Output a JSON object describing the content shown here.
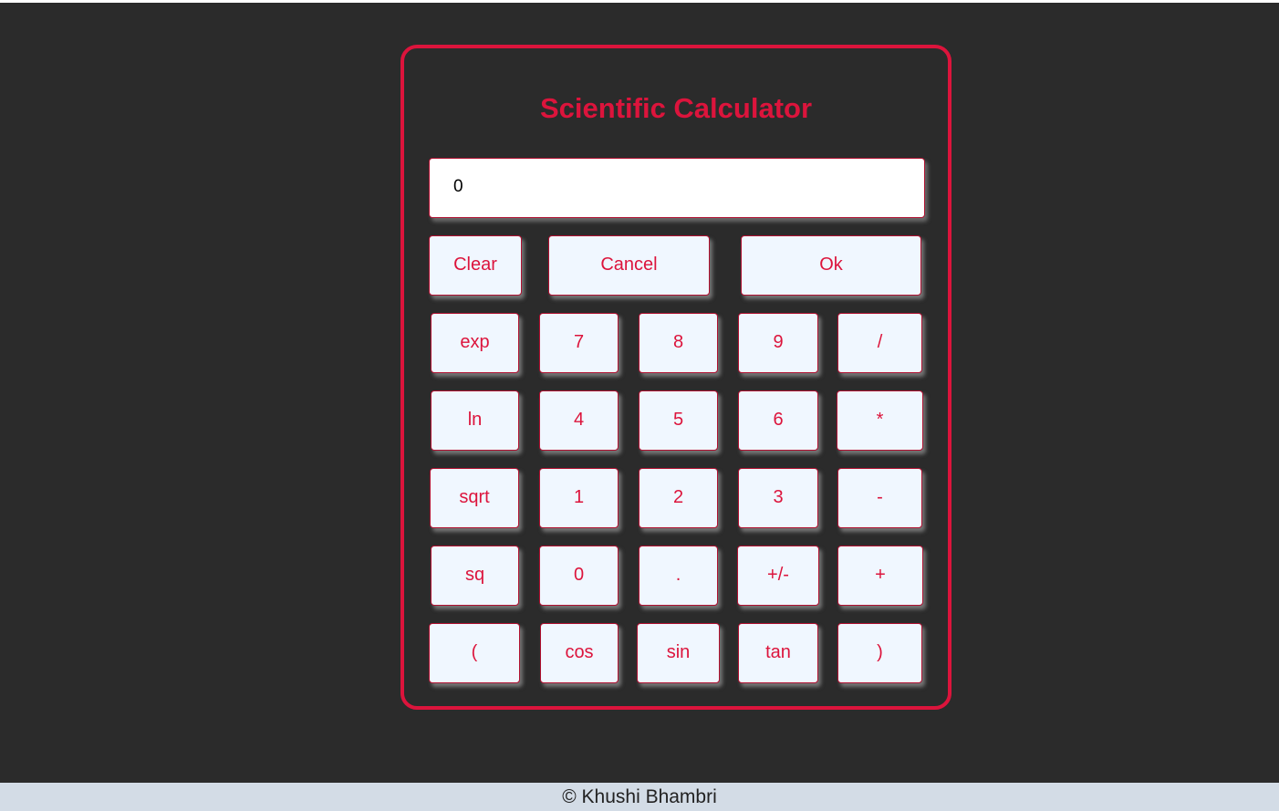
{
  "calculator": {
    "title": "Scientific Calculator",
    "display_value": "0",
    "top_row": {
      "clear": "Clear",
      "cancel": "Cancel",
      "ok": "Ok"
    },
    "rows": [
      [
        "exp",
        "7",
        "8",
        "9",
        "/"
      ],
      [
        "ln",
        "4",
        "5",
        "6",
        "*"
      ],
      [
        "sqrt",
        "1",
        "2",
        "3",
        "-"
      ],
      [
        "sq",
        "0",
        ".",
        "+/-",
        "+"
      ],
      [
        "(",
        "cos",
        "sin",
        "tan",
        ")"
      ]
    ],
    "accent_color": "#dc143c"
  },
  "footer": {
    "text": "© Khushi Bhambri"
  }
}
